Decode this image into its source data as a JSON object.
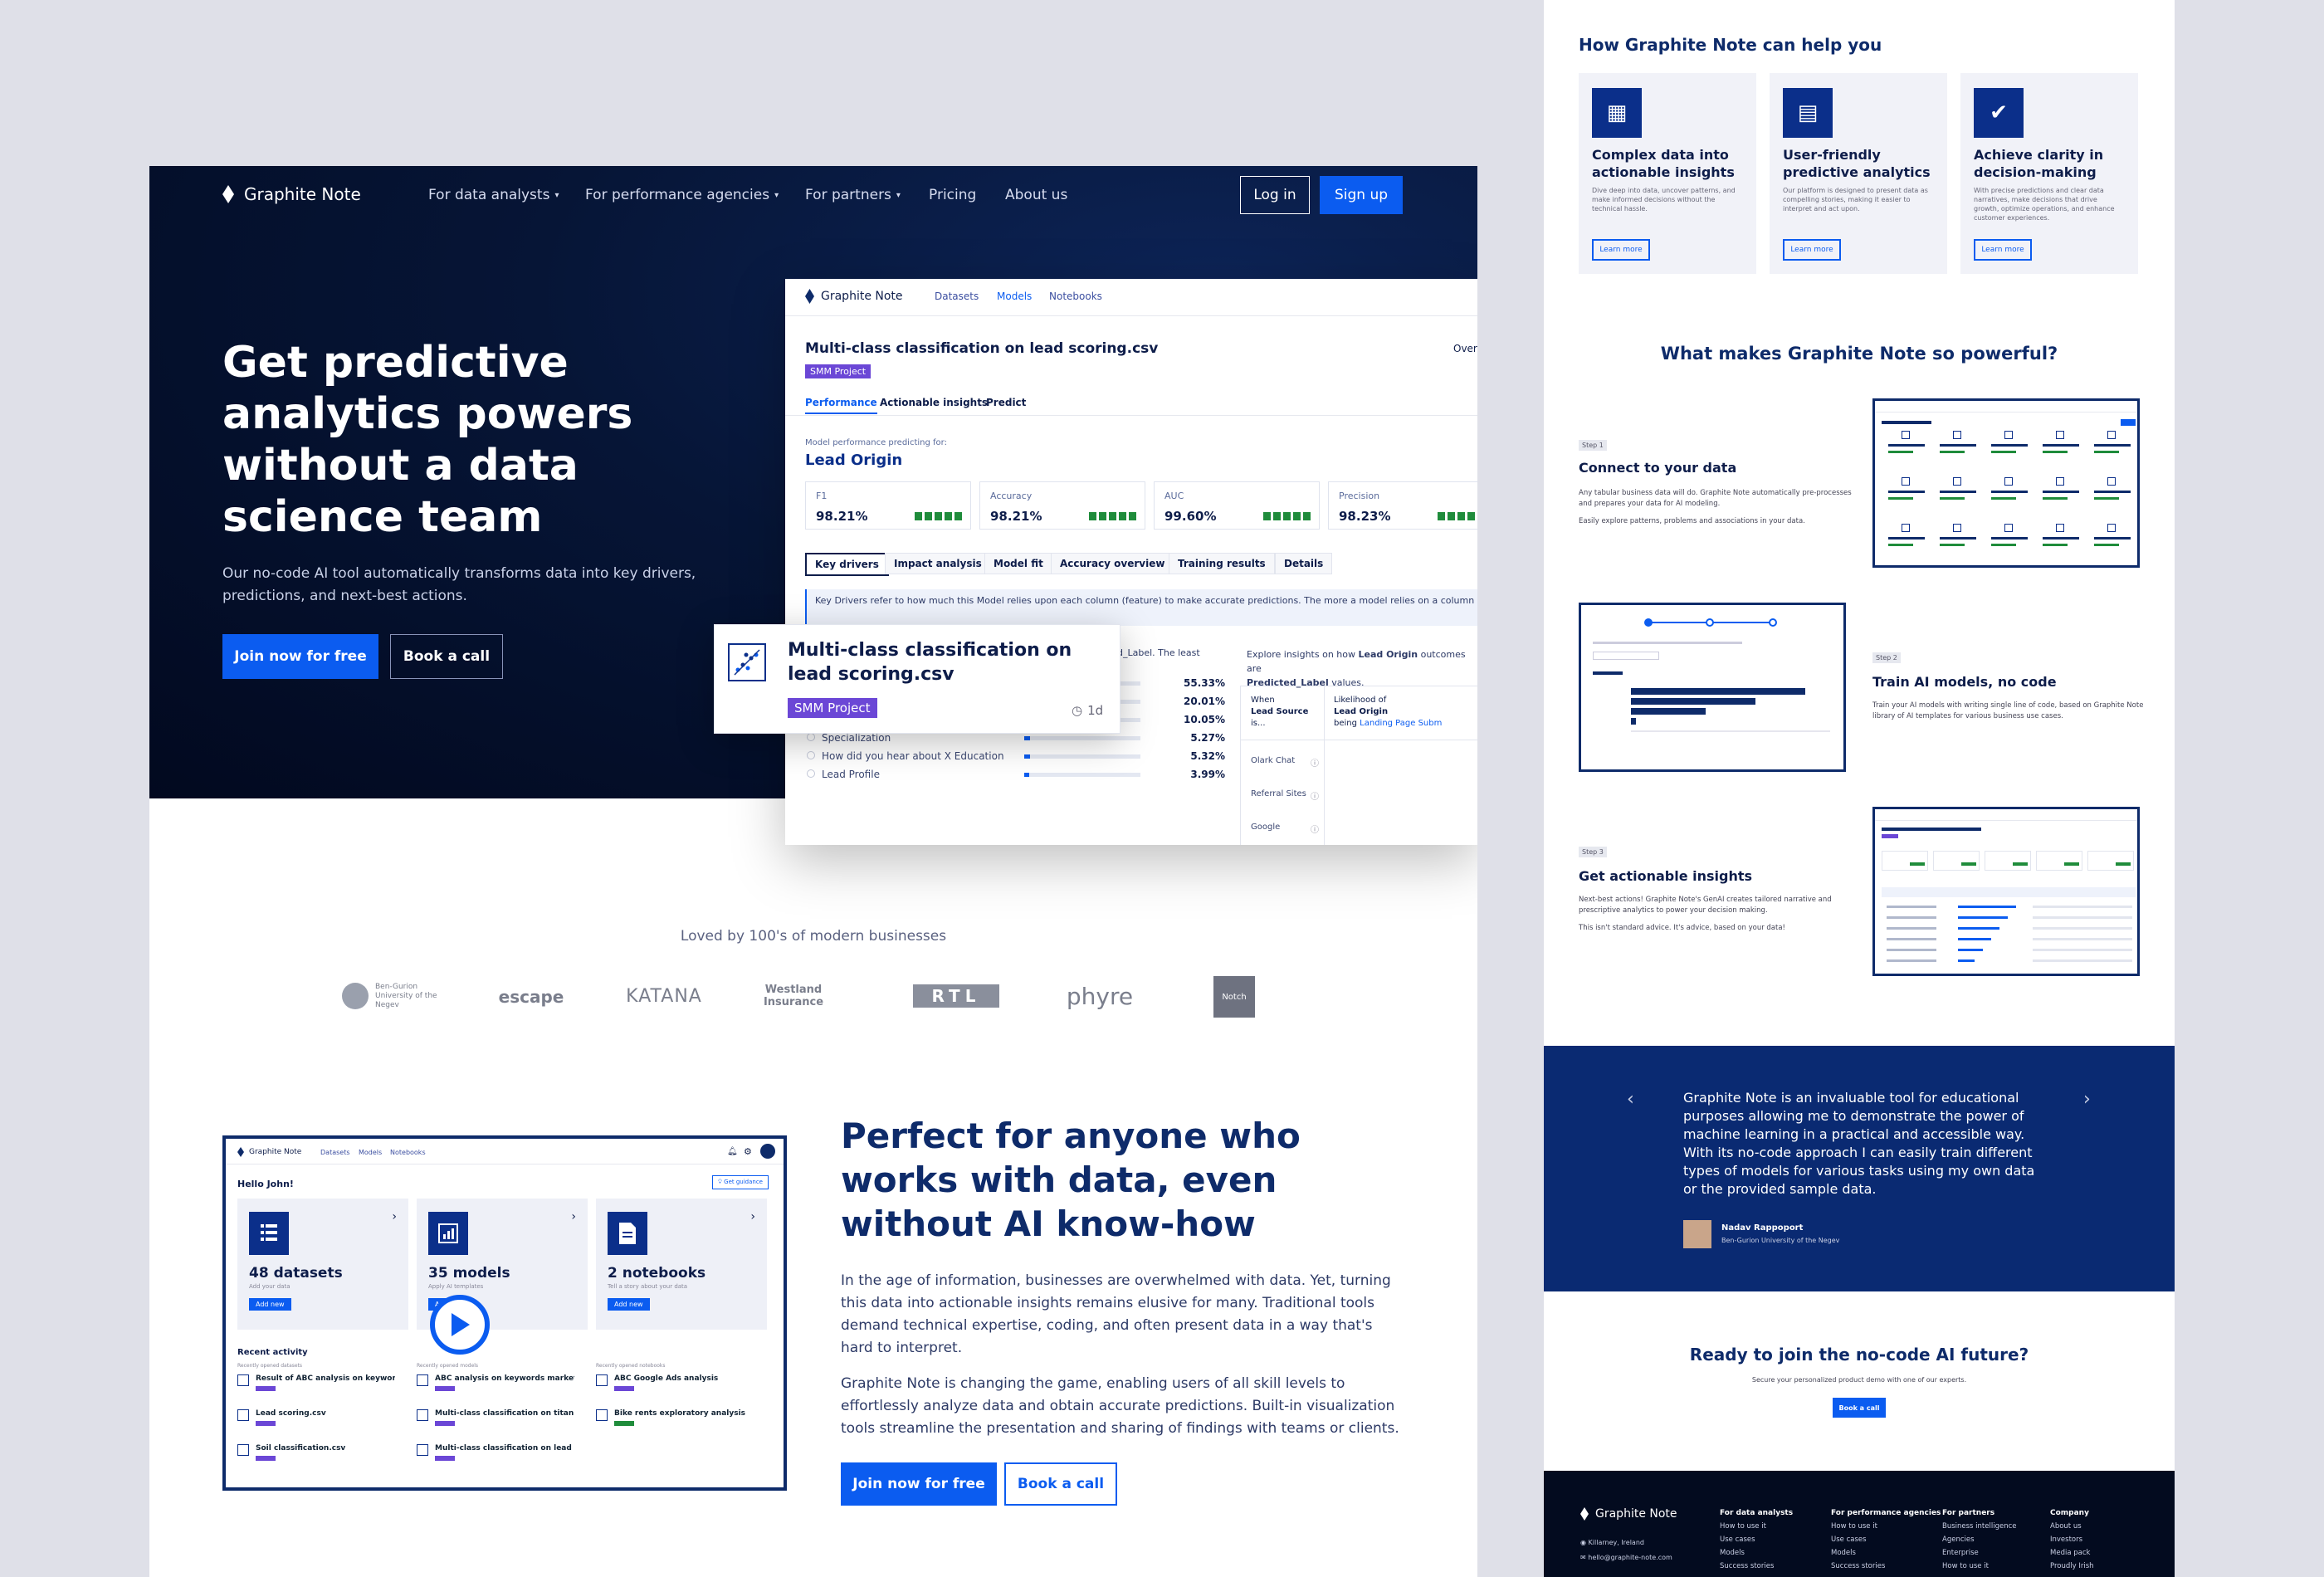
{
  "nav": {
    "brand": "Graphite Note",
    "items": [
      "For data analysts",
      "For performance agencies",
      "For partners",
      "Pricing",
      "About us"
    ],
    "login": "Log in",
    "signup": "Sign up"
  },
  "hero": {
    "title": "Get predictive analytics powers without a data science team",
    "subtitle": "Our no-code AI tool automatically transforms data into key drivers, predictions, and next-best actions.",
    "cta_primary": "Join now for free",
    "cta_secondary": "Book a call"
  },
  "mock": {
    "brand": "Graphite Note",
    "nav": [
      "Datasets",
      "Models",
      "Notebooks"
    ],
    "title": "Multi-class classification on lead scoring.csv",
    "tag": "SMM Project",
    "overall": "Overall",
    "tabs": [
      "Performance",
      "Actionable insights",
      "Predict"
    ],
    "predicting_label": "Model performance predicting for:",
    "target": "Lead Origin",
    "metrics": [
      {
        "label": "F1",
        "value": "98.21%"
      },
      {
        "label": "Accuracy",
        "value": "98.21%"
      },
      {
        "label": "AUC",
        "value": "99.60%"
      },
      {
        "label": "Precision",
        "value": "98.23%"
      }
    ],
    "subtabs": [
      "Key drivers",
      "Impact analysis",
      "Model fit",
      "Accuracy overview",
      "Training results",
      "Details"
    ],
    "info": "Key Drivers refer to how much this Model relies upon each column (feature) to make accurate predictions. The more a model relies on a column more important it is for the Model. Graphite uses a permutation feature importance for this calculation.",
    "label_frag": "d_Label. The least",
    "explore_pre": "Explore insights on how ",
    "explore_bold": "Lead Origin",
    "explore_mid": " outcomes are",
    "explore_line2": "Predicted_Label",
    "explore_post": " values.",
    "drivers": [
      {
        "name": "",
        "pct": "55.33%",
        "fill": 0.55
      },
      {
        "name": "",
        "pct": "20.01%",
        "fill": 0.2
      },
      {
        "name": "Page Views per Visit",
        "pct": "10.05%",
        "fill": 0.1
      },
      {
        "name": "Specialization",
        "pct": "5.27%",
        "fill": 0.05
      },
      {
        "name": "How did you hear about X Education",
        "pct": "5.32%",
        "fill": 0.05
      },
      {
        "name": "Lead Profile",
        "pct": "3.99%",
        "fill": 0.04
      }
    ],
    "when": "When",
    "lead_source": "Lead Source",
    "is": "is...",
    "likelihood": "Likelihood of",
    "likelihood_bold": "Lead Origin",
    "being": "being",
    "being_link": "Landing Page Subm",
    "sources": [
      "Olark Chat",
      "Referral Sites",
      "Google"
    ]
  },
  "floatcard": {
    "title": "Multi-class classification on lead scoring.csv",
    "tag": "SMM Project",
    "age": "1d"
  },
  "logos": {
    "caption": "Loved by 100's of modern businesses",
    "items": [
      "Ben-Gurion University of the Negev",
      "escape",
      "KATANA",
      "Westland Insurance",
      "RTL",
      "phyre",
      "Notch"
    ]
  },
  "section2": {
    "title": "Perfect for anyone who works with data, even without AI know-how",
    "p1": "In the age of information, businesses are overwhelmed with data. Yet, turning this data into actionable insights remains elusive for many. Traditional tools demand technical expertise, coding, and often present data in a way that's hard to interpret.",
    "p2": "Graphite Note is changing the game, enabling users of all skill levels to effortlessly analyze data and obtain accurate predictions. Built-in visualization tools streamline the presentation and sharing of findings with teams or clients.",
    "cta_primary": "Join now for free",
    "cta_secondary": "Book a call"
  },
  "dash": {
    "brand": "Graphite Note",
    "nav": [
      "Datasets",
      "Models",
      "Notebooks"
    ],
    "greeting": "Hello John!",
    "guidance": "Get guidance",
    "cards": [
      {
        "count": "48 datasets",
        "sub": "Add your data",
        "btn": "Add new"
      },
      {
        "count": "35 models",
        "sub": "Apply AI templates",
        "btn": "Add new"
      },
      {
        "count": "2 notebooks",
        "sub": "Tell a story about your data",
        "btn": "Add new"
      }
    ],
    "recent": "Recent activity",
    "cols": [
      "Recently opened datasets",
      "Recently opened models",
      "Recently opened notebooks"
    ],
    "col1": [
      "Result of ABC analysis on keyword...",
      "Lead scoring.csv",
      "Soil classification.csv"
    ],
    "col2": [
      "ABC analysis on keywords marketi...",
      "Multi-class classification on titani...",
      "Multi-class classification on lead s..."
    ],
    "col3": [
      "ABC Google Ads analysis",
      "Bike rents exploratory analysis"
    ]
  },
  "help": {
    "title": "How Graphite Note can help you",
    "cards": [
      {
        "title": "Complex data into actionable insights",
        "desc": "Dive deep into data, uncover patterns, and make informed decisions without the technical hassle.",
        "btn": "Learn more"
      },
      {
        "title": "User-friendly predictive analytics",
        "desc": "Our platform is designed to present data as compelling stories, making it easier to interpret and act upon.",
        "btn": "Learn more"
      },
      {
        "title": "Achieve clarity in decision-making",
        "desc": "With precise predictions and clear data narratives, make decisions that drive growth, optimize operations, and enhance customer experiences.",
        "btn": "Learn more"
      }
    ]
  },
  "powerful": {
    "title": "What makes Graphite Note so powerful?",
    "steps": [
      {
        "step": "Step 1",
        "title": "Connect to your data",
        "desc1": "Any tabular business data will do. Graphite Note automatically pre-processes and prepares your data for AI modeling.",
        "desc2": "Easily explore patterns, problems and associations in your data."
      },
      {
        "step": "Step 2",
        "title": "Train AI models, no code",
        "desc1": "Train your AI models with writing single line of code, based on Graphite Note library of AI templates for various business use cases.",
        "desc2": ""
      },
      {
        "step": "Step 3",
        "title": "Get actionable insights",
        "desc1": "Next-best actions! Graphite Note's GenAI creates tailored narrative and prescriptive analytics to power your decision making.",
        "desc2": "This isn't standard advice. It's advice, based on your data!"
      }
    ]
  },
  "testimonial": {
    "quote": "Graphite Note is an invaluable tool for educational purposes allowing me to demonstrate the power of machine learning in a practical and accessible way. With its no-code approach I can easily train different types of models for various tasks using my own data or the provided sample data.",
    "name": "Nadav Rappoport",
    "org": "Ben-Gurion University of the Negev"
  },
  "cta": {
    "title": "Ready to join the no-code AI future?",
    "sub": "Secure your personalized product demo with one of our experts.",
    "btn": "Book a call"
  },
  "footer": {
    "brand": "Graphite Note",
    "location": "Killarney, Ireland",
    "email": "hello@graphite-note.com",
    "cols": [
      {
        "h": "For data analysts",
        "items": [
          "How to use it",
          "Use cases",
          "Models",
          "Success stories"
        ]
      },
      {
        "h": "For performance agencies",
        "items": [
          "How to use it",
          "Use cases",
          "Models",
          "Success stories"
        ]
      },
      {
        "h": "For partners",
        "items": [
          "Business intelligence",
          "Agencies",
          "Enterprise",
          "How to use it"
        ]
      },
      {
        "h": "Company",
        "items": [
          "About us",
          "Investors",
          "Media pack",
          "Proudly Irish"
        ]
      }
    ]
  },
  "colors": {
    "navy": "#061536",
    "accent": "#0b5cf0",
    "tag": "#6b47d6",
    "good": "#1f8c3b"
  }
}
